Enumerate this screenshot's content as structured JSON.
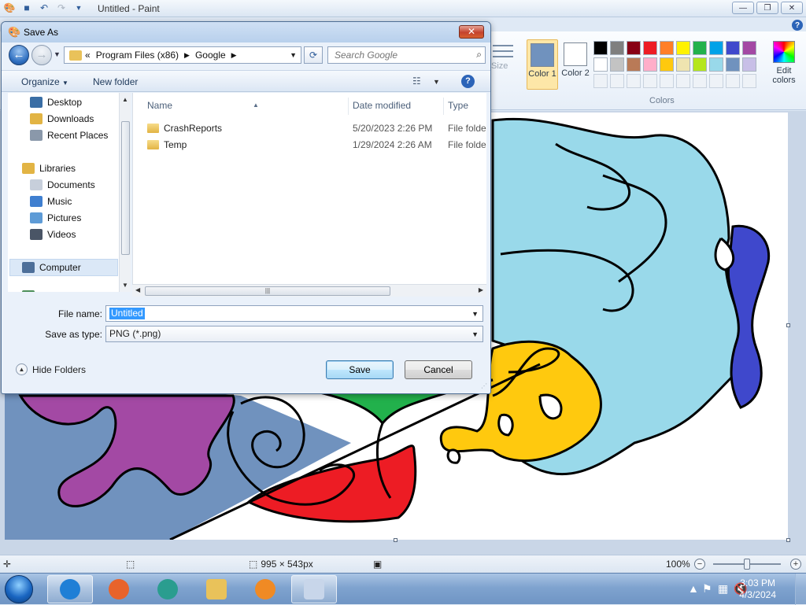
{
  "paint": {
    "title": "Untitled - Paint",
    "ribbon": {
      "size_label": "Size",
      "color1_label": "Color 1",
      "color2_label": "Color 2",
      "colors_group_label": "Colors",
      "edit_colors_label": "Edit colors",
      "color1_value": "#7092be",
      "color2_value": "#ffffff",
      "palette_row1": [
        "#000000",
        "#7f7f7f",
        "#880015",
        "#ed1c24",
        "#ff7f27",
        "#fff200",
        "#22b14c",
        "#00a2e8",
        "#3f48cc",
        "#a349a4"
      ],
      "palette_row2": [
        "#ffffff",
        "#c3c3c3",
        "#b97a57",
        "#ffaec9",
        "#ffc90e",
        "#efe4b0",
        "#b5e61d",
        "#99d9ea",
        "#7092be",
        "#c8bfe7"
      ]
    },
    "canvas": {
      "fill_colors": {
        "light_blue": "#99d9ea",
        "dark_blue": "#3f48cc",
        "yellow": "#ffc90e",
        "red": "#ed1c24",
        "green": "#22b14c",
        "purple": "#a349a4",
        "steel_blue": "#7092be"
      }
    },
    "status": {
      "dimensions": "995 × 543px",
      "zoom": "100%",
      "zoom_fraction": 0.5
    }
  },
  "dialog": {
    "title": "Save As",
    "close_glyph": "✕",
    "address": {
      "overflow": "«",
      "crumbs": [
        "Program Files (x86)",
        "Google"
      ]
    },
    "search_placeholder": "Search Google",
    "toolbar": {
      "organize": "Organize",
      "new_folder": "New folder"
    },
    "nav_items": [
      {
        "label": "Desktop",
        "icon": "desktop-icon",
        "color": "#3a6ea5"
      },
      {
        "label": "Downloads",
        "icon": "downloads-folder-icon",
        "color": "#e2b444"
      },
      {
        "label": "Recent Places",
        "icon": "recent-places-icon",
        "color": "#8a98aa"
      },
      {
        "label": "Libraries",
        "icon": "libraries-icon",
        "color": "#e2b444"
      },
      {
        "label": "Documents",
        "icon": "documents-icon",
        "color": "#c7cfdb"
      },
      {
        "label": "Music",
        "icon": "music-icon",
        "color": "#3f7fd0"
      },
      {
        "label": "Pictures",
        "icon": "pictures-icon",
        "color": "#5e9bd6"
      },
      {
        "label": "Videos",
        "icon": "videos-icon",
        "color": "#4a5566"
      },
      {
        "label": "Computer",
        "icon": "computer-icon",
        "color": "#4d6f99"
      },
      {
        "label": "Network",
        "icon": "network-icon",
        "color": "#4d8f5a"
      }
    ],
    "columns": [
      "Name",
      "Date modified",
      "Type"
    ],
    "files": [
      {
        "name": "CrashReports",
        "date": "5/20/2023 2:26 PM",
        "type": "File folder"
      },
      {
        "name": "Temp",
        "date": "1/29/2024 2:26 AM",
        "type": "File folder"
      }
    ],
    "file_name_label": "File name:",
    "file_name_value": "Untitled",
    "save_type_label": "Save as type:",
    "save_type_value": "PNG (*.png)",
    "hide_folders": "Hide Folders",
    "save_button": "Save",
    "cancel_button": "Cancel"
  },
  "taskbar": {
    "time": "3:03 PM",
    "date": "4/3/2024",
    "apps": [
      {
        "name": "internet-explorer",
        "color": "#1f7fd6"
      },
      {
        "name": "firefox",
        "color": "#e8632b"
      },
      {
        "name": "app-teal",
        "color": "#2a9d8f"
      },
      {
        "name": "file-explorer",
        "color": "#e9c25a"
      },
      {
        "name": "media-player",
        "color": "#f08a24"
      },
      {
        "name": "paint",
        "color": "#c8d6ea"
      }
    ]
  }
}
